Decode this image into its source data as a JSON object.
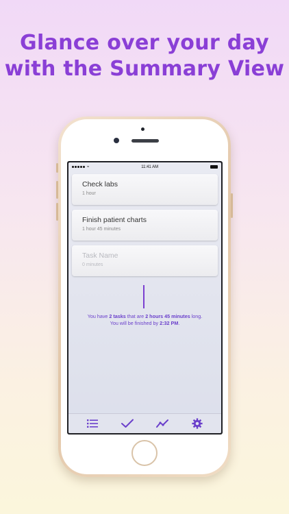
{
  "headline": {
    "line1": "Glance over your day",
    "line2": "with the Summary View"
  },
  "status_bar": {
    "time": "11:41 AM",
    "wifi_icon": "wifi-icon"
  },
  "tasks": [
    {
      "title": "Check labs",
      "duration": "1 hour"
    },
    {
      "title": "Finish patient charts",
      "duration": "1 hour 45 minutes"
    }
  ],
  "new_task": {
    "placeholder_title": "Task Name",
    "placeholder_duration": "0 minutes"
  },
  "summary": {
    "line1_prefix": "You have ",
    "task_count": "2 tasks",
    "line1_mid": " that are ",
    "total_time": "2 hours 45 minutes",
    "line1_suffix": " long.",
    "line2_prefix": "You will be finished by ",
    "finish_time": "2:32 PM",
    "line2_suffix": "."
  },
  "tabbar": {
    "accent_color": "#6a3fcb",
    "icons": [
      "list-icon",
      "checkmark-icon",
      "trend-icon",
      "gear-icon"
    ]
  },
  "colors": {
    "headline": "#8a3fd6",
    "accent": "#6a3fcb"
  }
}
